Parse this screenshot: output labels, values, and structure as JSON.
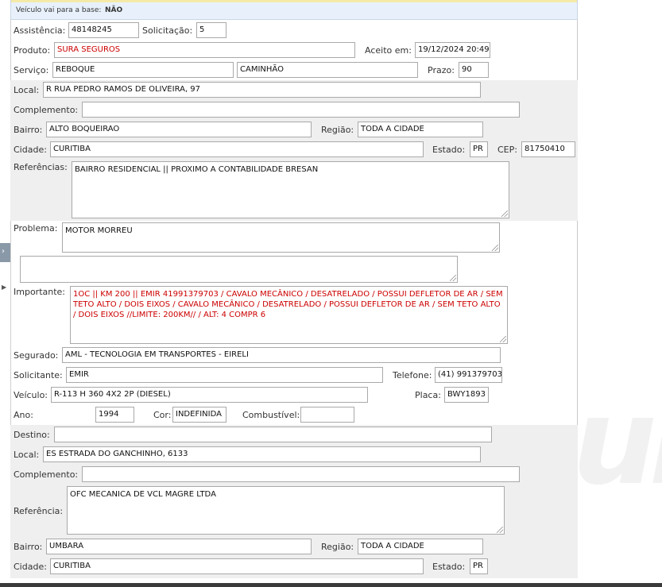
{
  "header": {
    "label": "Veículo vai para a base:",
    "value": "NÃO"
  },
  "assistencia": {
    "label": "Assistência:",
    "value": "48148245"
  },
  "solicitacao": {
    "label": "Solicitação:",
    "value": "5"
  },
  "produto": {
    "label": "Produto:",
    "value": "SURA SEGUROS"
  },
  "aceito": {
    "label": "Aceito em:",
    "value": "19/12/2024 20:49"
  },
  "servico": {
    "label": "Serviço:",
    "value": "REBOQUE",
    "value2": "CAMINHÃO"
  },
  "prazo": {
    "label": "Prazo:",
    "value": "90"
  },
  "origem": {
    "local": {
      "label": "Local:",
      "value": "R RUA PEDRO RAMOS DE OLIVEIRA, 97"
    },
    "complemento": {
      "label": "Complemento:",
      "value": ""
    },
    "bairro": {
      "label": "Bairro:",
      "value": "ALTO BOQUEIRAO"
    },
    "regiao": {
      "label": "Região:",
      "value": "TODA A CIDADE"
    },
    "cidade": {
      "label": "Cidade:",
      "value": "CURITIBA"
    },
    "estado": {
      "label": "Estado:",
      "value": "PR"
    },
    "cep": {
      "label": "CEP:",
      "value": "81750410"
    },
    "referencias": {
      "label": "Referências:",
      "value": "BAIRRO RESIDENCIAL  || PROXIMO A CONTABILIDADE BRESAN"
    }
  },
  "problema": {
    "label": "Problema:",
    "value": "MOTOR MORREU",
    "extra": ""
  },
  "importante": {
    "label": "Importante:",
    "value": "1OC || KM 200 || EMIR 41991379703  / CAVALO MECÂNICO / DESATRELADO / POSSUI DEFLETOR DE AR / SEM TETO ALTO / DOIS EIXOS / CAVALO MECÂNICO / DESATRELADO / POSSUI DEFLETOR DE AR / SEM TETO ALTO / DOIS EIXOS //LIMITE: 200KM// / ALT: 4 COMPR 6"
  },
  "segurado": {
    "label": "Segurado:",
    "value": "AML - TECNOLOGIA EM TRANSPORTES - EIRELI"
  },
  "solicitante": {
    "label": "Solicitante:",
    "value": "EMIR"
  },
  "telefone": {
    "label": "Telefone:",
    "value": "(41) 991379703"
  },
  "veiculo": {
    "label": "Veículo:",
    "value": "R-113 H 360 4X2 2P (DIESEL)"
  },
  "placa": {
    "label": "Placa:",
    "value": "BWY1893"
  },
  "ano": {
    "label": "Ano:",
    "value": "1994"
  },
  "cor": {
    "label": "Cor:",
    "value": "INDEFINIDA"
  },
  "combustivel": {
    "label": "Combustível:",
    "value": ""
  },
  "destino": {
    "destino": {
      "label": "Destino:",
      "value": ""
    },
    "local": {
      "label": "Local:",
      "value": "ES ESTRADA DO GANCHINHO, 6133"
    },
    "complemento": {
      "label": "Complemento:",
      "value": ""
    },
    "referencia": {
      "label": "Referência:",
      "value": "OFC MECANICA  DE VCL MAGRE LTDA"
    },
    "bairro": {
      "label": "Bairro:",
      "value": "UMBARA"
    },
    "regiao": {
      "label": "Região:",
      "value": "TODA A CIDADE"
    },
    "cidade": {
      "label": "Cidade:",
      "value": "CURITIBA"
    },
    "estado": {
      "label": "Estado:",
      "value": "PR"
    }
  },
  "sidebar": {
    "tab_icon": "chevron-right-icon",
    "arrow_icon": "triangle-right-icon"
  },
  "colors": {
    "accent_red": "#cc0000",
    "header_bg": "#e8f1fb",
    "section_gray": "#efefef"
  }
}
